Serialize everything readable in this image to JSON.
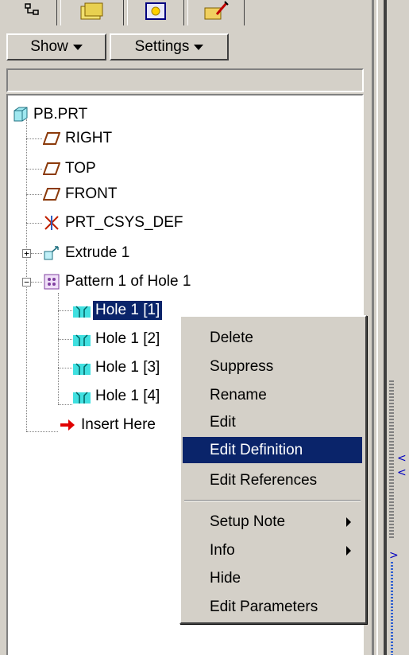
{
  "toolbar": {
    "show_label": "Show",
    "settings_label": "Settings"
  },
  "tabs": [
    {
      "icon": "model-tree-icon"
    },
    {
      "icon": "folder-browser-icon"
    },
    {
      "icon": "favorites-icon"
    },
    {
      "icon": "connections-icon"
    }
  ],
  "tree": {
    "root": "PB.PRT",
    "items": [
      {
        "label": "RIGHT",
        "icon": "datum-plane-icon"
      },
      {
        "label": "TOP",
        "icon": "datum-plane-icon"
      },
      {
        "label": "FRONT",
        "icon": "datum-plane-icon"
      },
      {
        "label": "PRT_CSYS_DEF",
        "icon": "csys-icon"
      },
      {
        "label": "Extrude 1",
        "icon": "extrude-icon"
      },
      {
        "label": "Pattern 1 of Hole 1",
        "icon": "pattern-icon"
      },
      {
        "label": "Hole 1 [1]",
        "icon": "hole-icon"
      },
      {
        "label": "Hole 1 [2]",
        "icon": "hole-icon"
      },
      {
        "label": "Hole 1 [3]",
        "icon": "hole-icon"
      },
      {
        "label": "Hole 1 [4]",
        "icon": "hole-icon"
      },
      {
        "label": "Insert Here",
        "icon": "insert-arrow-icon"
      }
    ]
  },
  "context_menu": {
    "items": [
      {
        "label": "Delete"
      },
      {
        "label": "Suppress"
      },
      {
        "label": "Rename"
      },
      {
        "label": "Edit"
      },
      {
        "label": "Edit Definition"
      },
      {
        "label": "Edit References"
      },
      {
        "label": "Setup Note"
      },
      {
        "label": "Info"
      },
      {
        "label": "Hide"
      },
      {
        "label": "Edit Parameters"
      }
    ],
    "highlighted": "Edit Definition"
  },
  "colors": {
    "selection": "#0a246a",
    "face": "#d4d0c8",
    "hole_icon": "#40e0e0",
    "datum_plane": "#8b3a0a"
  }
}
